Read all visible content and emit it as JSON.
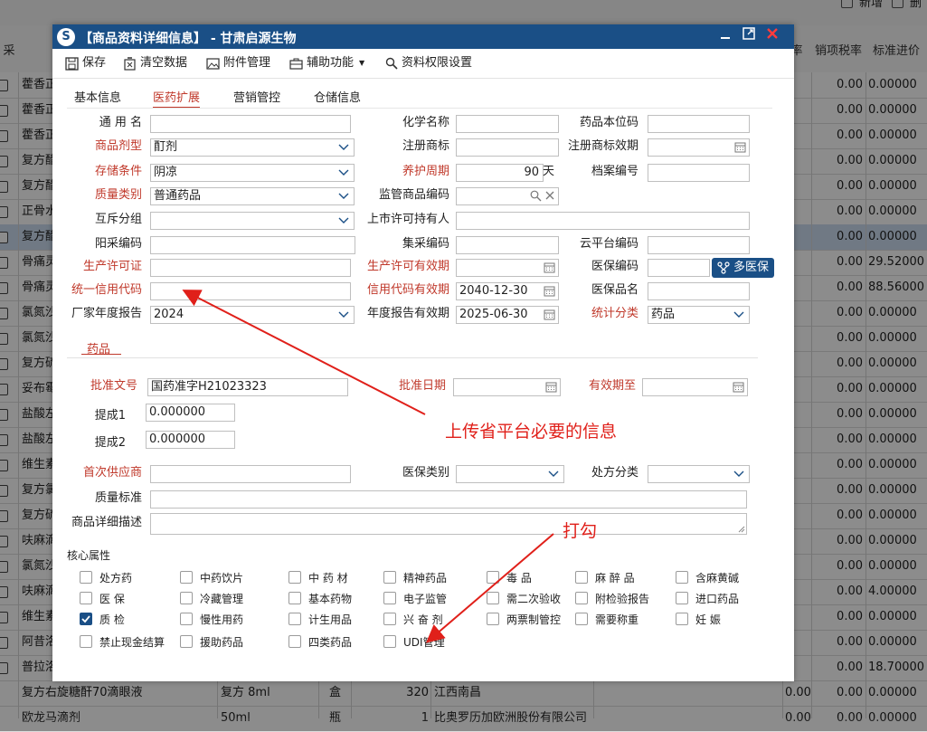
{
  "background": {
    "top_actions": [
      "新增",
      "删"
    ],
    "headers": [
      "采",
      "率",
      "销项税率",
      "标准进价"
    ],
    "rows": [
      {
        "name": "藿香正",
        "rate": "0.00",
        "price": "0.00000"
      },
      {
        "name": "藿香正",
        "rate": "0.00",
        "price": "0.00000"
      },
      {
        "name": "藿香正",
        "rate": "0.00",
        "price": "0.00000"
      },
      {
        "name": "复方醋",
        "rate": "0.00",
        "price": "0.00000"
      },
      {
        "name": "复方醋",
        "rate": "0.00",
        "price": "0.00000"
      },
      {
        "name": "正骨水",
        "rate": "0.00",
        "price": "0.00000"
      },
      {
        "name": "复方醋",
        "rate": "0.00",
        "price": "0.00000"
      },
      {
        "name": "骨痛灵",
        "rate": "0.00",
        "price": "29.52000"
      },
      {
        "name": "骨痛灵",
        "rate": "0.00",
        "price": "88.56000"
      },
      {
        "name": "氯氮沙",
        "rate": "0.00",
        "price": "0.00000"
      },
      {
        "name": "氯氮沙",
        "rate": "0.00",
        "price": "0.00000"
      },
      {
        "name": "复方硫",
        "rate": "0.00",
        "price": "0.00000"
      },
      {
        "name": "妥布霉",
        "rate": "0.00",
        "price": "0.00000"
      },
      {
        "name": "盐酸左",
        "rate": "0.00",
        "price": "0.00000"
      },
      {
        "name": "盐酸左",
        "rate": "0.00",
        "price": "0.00000"
      },
      {
        "name": "维生素",
        "rate": "0.00",
        "price": "0.00000"
      },
      {
        "name": "复方氯",
        "rate": "0.00",
        "price": "0.00000"
      },
      {
        "name": "复方硫",
        "rate": "0.00",
        "price": "0.00000"
      },
      {
        "name": "呋麻滴",
        "rate": "0.00",
        "price": "0.00000"
      },
      {
        "name": "氯氮沙",
        "rate": "0.00",
        "price": "0.00000"
      },
      {
        "name": "呋麻滴",
        "rate": "0.00",
        "price": "4.00000"
      },
      {
        "name": "维生素",
        "rate": "0.00",
        "price": "0.00000"
      },
      {
        "name": "阿昔洛",
        "rate": "0.00",
        "price": "0.00000"
      },
      {
        "name": "普拉洛",
        "rate": "0.00",
        "price": "18.70000"
      }
    ],
    "bottom_rows": [
      {
        "name": "复方右旋糖酐70滴眼液",
        "spec": "复方 8ml",
        "unit": "盒",
        "qty": "320",
        "maker": "江西南昌",
        "rate1": "0.00",
        "rate2": "0.00",
        "price": "0.00000"
      },
      {
        "name": "欧龙马滴剂",
        "spec": "50ml",
        "unit": "瓶",
        "qty": "1",
        "maker": "比奥罗历加欧洲股份有限公司",
        "rate1": "0.00",
        "rate2": "0.00",
        "price": "0.00000"
      }
    ]
  },
  "dialog": {
    "title": "【商品资料详细信息】 - 甘肃启源生物",
    "logo": "S",
    "toolbar": {
      "save": "保存",
      "clear": "清空数据",
      "attach": "附件管理",
      "aux": "辅助功能",
      "perm": "资料权限设置"
    },
    "tabs": [
      "基本信息",
      "医药扩展",
      "营销管控",
      "仓储信息"
    ],
    "labels": {
      "generic_name": "通 用 名",
      "chem_name": "化学名称",
      "drug_unit_code": "药品本位码",
      "dosage_form": "商品剂型",
      "reg_trademark": "注册商标",
      "trademark_validity": "注册商标效期",
      "storage": "存储条件",
      "maint_cycle": "养护周期",
      "archive_no": "档案编号",
      "quality_type": "质量类别",
      "supervise_code": "监管商品编码",
      "mutex_group": "互斥分组",
      "mah": "上市许可持有人",
      "sun_code": "阳采编码",
      "collect_code": "集采编码",
      "cloud_code": "云平台编码",
      "prod_license": "生产许可证",
      "prod_license_validity": "生产许可有效期",
      "medins_code": "医保编码",
      "credit_code": "统一信用代码",
      "credit_validity": "信用代码有效期",
      "medins_name": "医保品名",
      "annual_report": "厂家年度报告",
      "report_validity": "年度报告有效期",
      "stat_category": "统计分类"
    },
    "values": {
      "dosage_form": "酊剂",
      "storage": "阴凉",
      "maint_cycle": "90",
      "maint_unit": "天",
      "quality_type": "普通药品",
      "credit_validity": "2040-12-30",
      "annual_report": "2024",
      "report_validity": "2025-06-30",
      "stat_category": "药品"
    },
    "multi_medins_btn": "多医保",
    "drug_section": {
      "title": "药品",
      "approval_no_label": "批准文号",
      "approval_no": "国药准字H21023323",
      "approval_date_label": "批准日期",
      "valid_until_label": "有效期至",
      "extract1_label": "提成1",
      "extract1": "0.000000",
      "extract2_label": "提成2",
      "extract2": "0.000000"
    },
    "lower": {
      "first_supplier_label": "首次供应商",
      "medins_type_label": "医保类别",
      "rx_class_label": "处方分类",
      "quality_std_label": "质量标准",
      "detail_desc_label": "商品详细描述"
    },
    "core": {
      "title": "核心属性",
      "items": [
        [
          "处方药",
          "中药饮片",
          "中 药 材",
          "精神药品",
          "毒 品",
          "麻 醉 品",
          "含麻黄碱"
        ],
        [
          "医 保",
          "冷藏管理",
          "基本药物",
          "电子监管",
          "需二次验收",
          "附检验报告",
          "进口药品"
        ],
        [
          "质 检",
          "慢性用药",
          "计生用品",
          "兴 奋 剂",
          "两票制管控",
          "需要称重",
          "妊 娠"
        ],
        [
          "禁止现金结算",
          "援助药品",
          "四类药品",
          "UDI管理"
        ]
      ],
      "checked": [
        "质 检"
      ]
    }
  },
  "annotations": {
    "note1": "上传省平台必要的信息",
    "note2": "打勾"
  },
  "colors": {
    "title_bar": "#1a4f86",
    "required_label": "#c0392b",
    "annotation": "#e0201a"
  }
}
